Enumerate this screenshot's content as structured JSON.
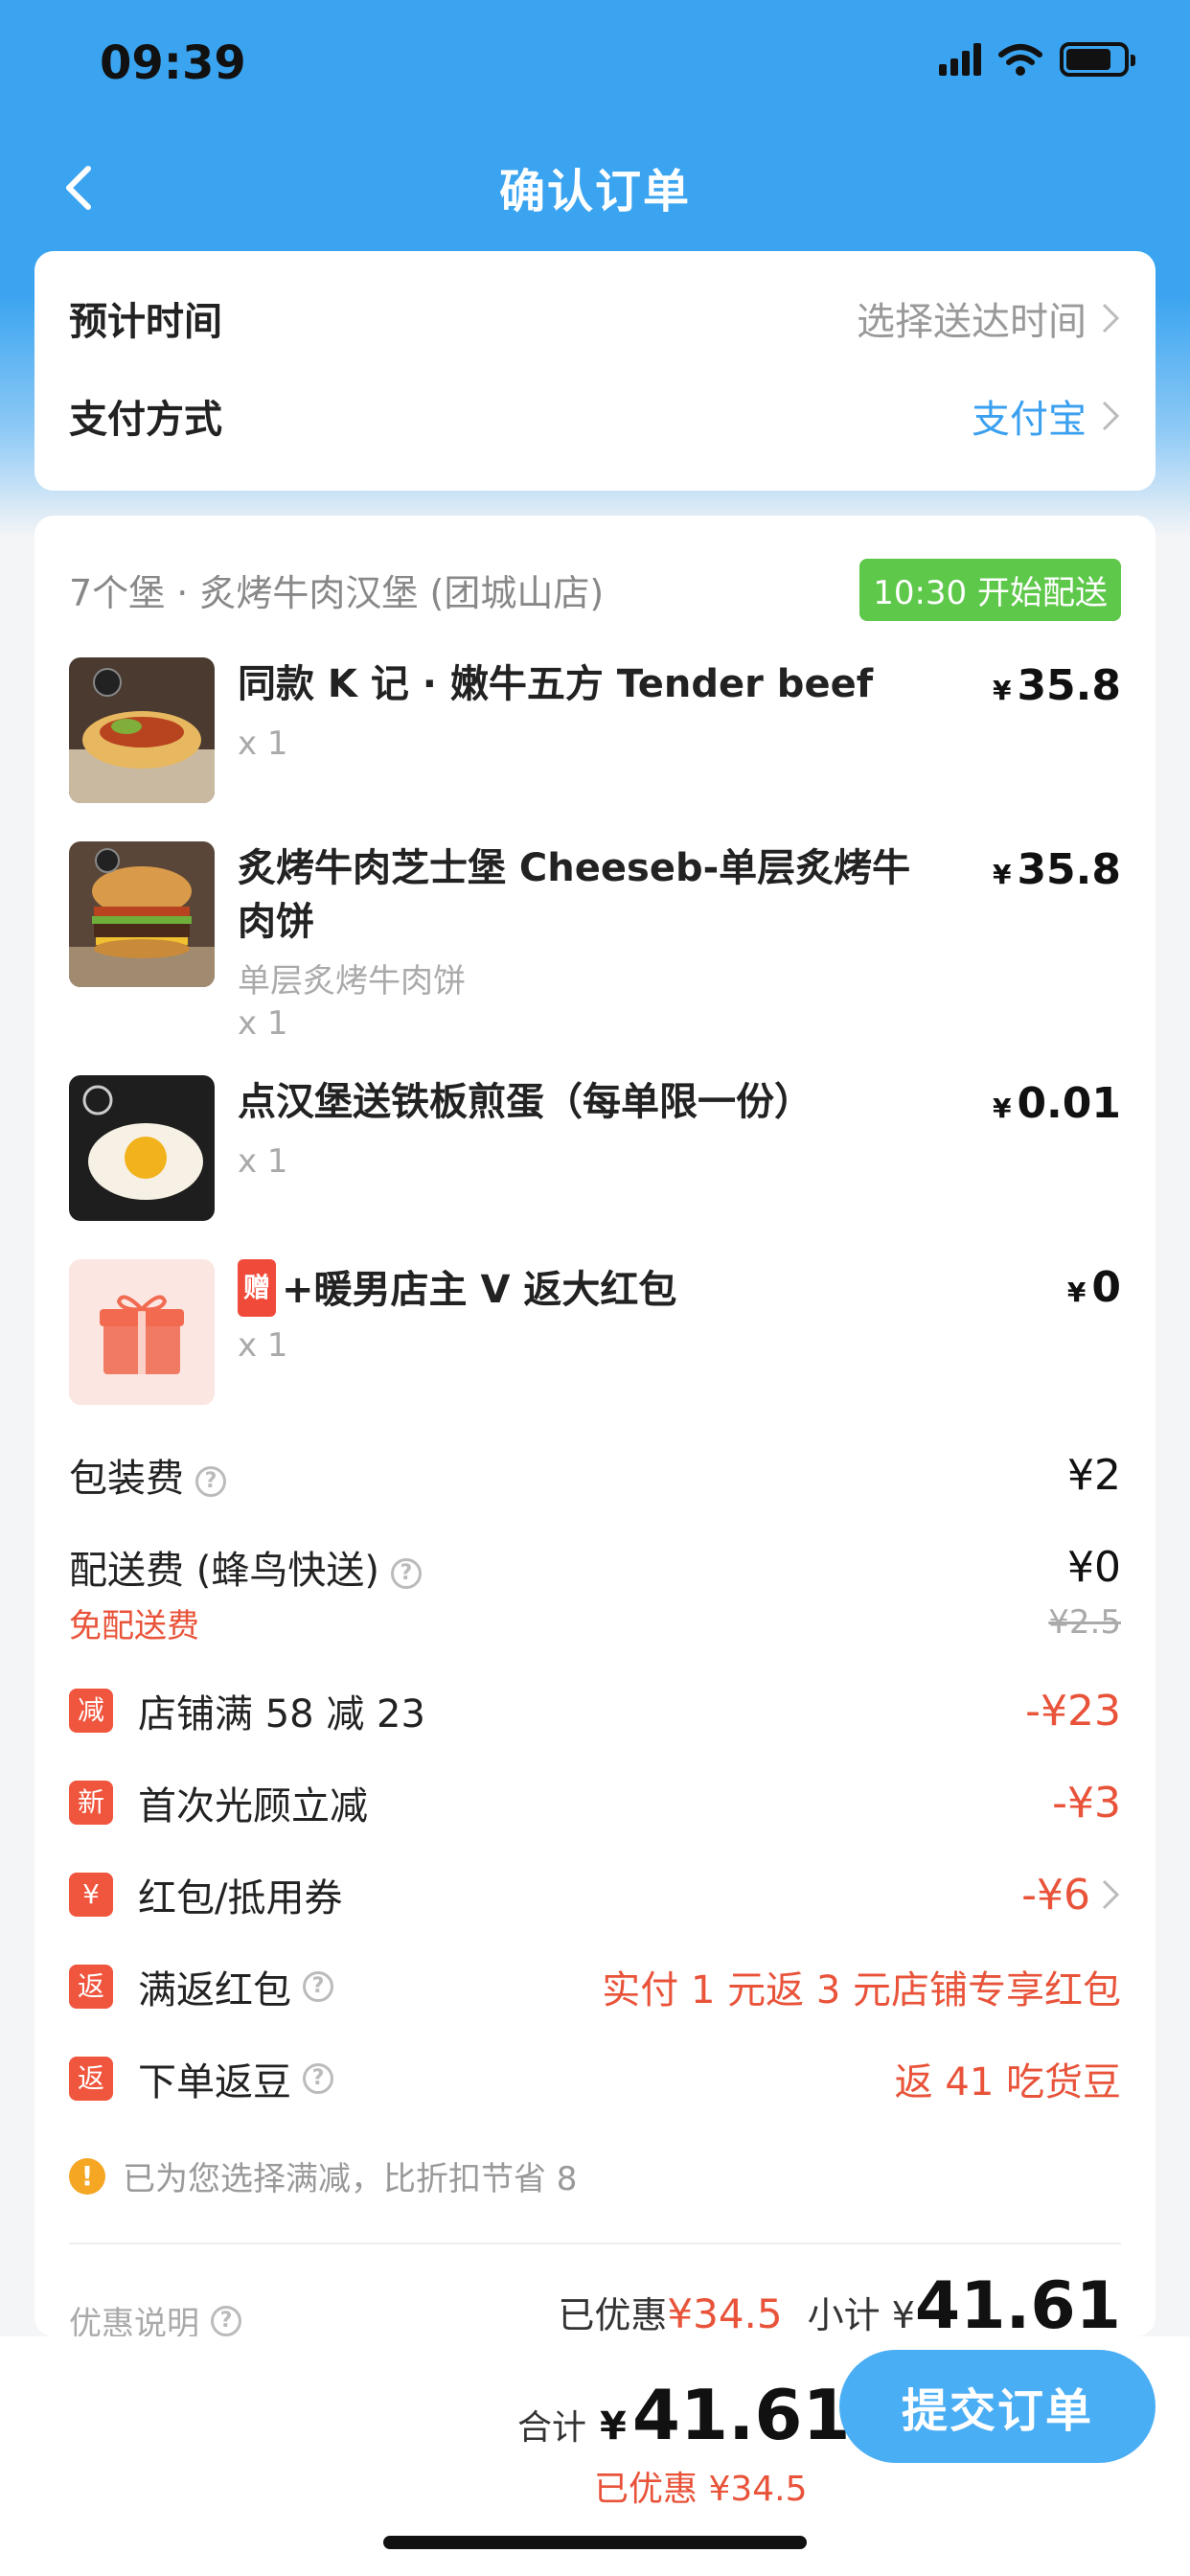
{
  "status_bar": {
    "time": "09:39"
  },
  "nav": {
    "title": "确认订单"
  },
  "delivery": {
    "time_label": "预计时间",
    "time_value": "选择送达时间",
    "pay_label": "支付方式",
    "pay_value": "支付宝"
  },
  "shop": {
    "name": "7个堡 · 炙烤牛肉汉堡 (团城山店)",
    "badge": "10:30 开始配送"
  },
  "items": [
    {
      "name": "同款 K 记 · 嫩牛五方 Tender beef",
      "sub": "",
      "qty": "x 1",
      "yen": "¥",
      "price": "35.8"
    },
    {
      "name": "炙烤牛肉芝士堡 Cheeseb-单层炙烤牛肉饼",
      "sub": "单层炙烤牛肉饼",
      "qty": "x 1",
      "yen": "¥",
      "price": "35.8"
    },
    {
      "name": "点汉堡送铁板煎蛋（每单限一份）",
      "sub": "",
      "qty": "x 1",
      "yen": "¥",
      "price": "0.01"
    },
    {
      "tag": "赠",
      "name": "+暖男店主 V 返大红包",
      "sub": "",
      "qty": "x 1",
      "yen": "¥",
      "price": "0"
    }
  ],
  "fees": {
    "packaging_label": "包装费",
    "packaging_value": "¥2",
    "delivery_label": "配送费 (蜂鸟快送)",
    "delivery_value": "¥0",
    "free_delivery": "免配送费",
    "delivery_original": "¥2.5"
  },
  "promos": [
    {
      "badge": "减",
      "label": "店铺满 58 减 23",
      "value": "-¥23"
    },
    {
      "badge": "新",
      "label": "首次光顾立减",
      "value": "-¥3"
    },
    {
      "badge": "¥",
      "label": "红包/抵用券",
      "value": "-¥6"
    },
    {
      "badge": "返",
      "label": "满返红包",
      "value": "实付 1 元返 3 元店铺专享红包"
    },
    {
      "badge": "返",
      "label": "下单返豆",
      "value": "返 41 吃货豆"
    }
  ],
  "notice": "已为您选择满减，比折扣节省 8",
  "summary": {
    "label": "优惠说明",
    "discount_label": "已优惠",
    "discount_value": "¥34.5",
    "subtotal_label": "小计 ¥",
    "subtotal_value": "41.61"
  },
  "bottom": {
    "total_label": "合计",
    "total_yen": "¥",
    "total_value": "41.61",
    "saved": "已优惠 ¥34.5",
    "submit": "提交订单"
  },
  "colors": {
    "header_blue": "#3ba4f0",
    "accent_red": "#e8533a",
    "badge_green": "#5ec84a",
    "button_blue": "#4aaef5"
  }
}
